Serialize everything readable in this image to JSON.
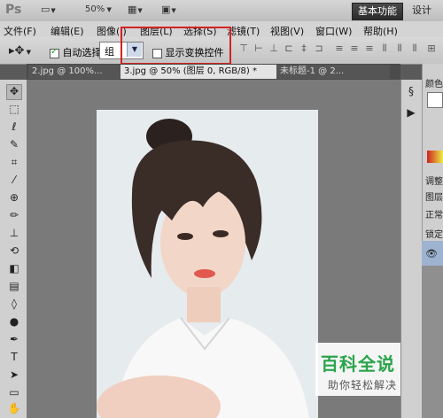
{
  "app": {
    "logo": "Ps",
    "zoom": "50%",
    "workspace": "基本功能",
    "design": "设计"
  },
  "menu": [
    "文件(F)",
    "编辑(E)",
    "图像(I)",
    "图层(L)",
    "选择(S)",
    "滤镜(T)",
    "视图(V)",
    "窗口(W)",
    "帮助(H)"
  ],
  "options": {
    "auto_select_label": "自动选择:",
    "auto_select_value": "组",
    "transform_label": "显示变换控件",
    "auto_select_checked": true
  },
  "tabs": [
    {
      "label": "2.jpg @ 100%..."
    },
    {
      "label": "3.jpg @ 50% (图层 0, RGB/8) *"
    },
    {
      "label": "未标题-1 @ 2..."
    }
  ],
  "right_panel": {
    "color": "颜色",
    "adjust": "调整",
    "layers": "图层",
    "mode": "正常",
    "lock": "锁定"
  },
  "watermark": {
    "title": "百科全说",
    "subtitle": "助你轻松解决"
  },
  "colors": {
    "highlight": "#d42222",
    "watermark_green": "#2aa44a",
    "workspace_bg": "#2b2b2b"
  }
}
